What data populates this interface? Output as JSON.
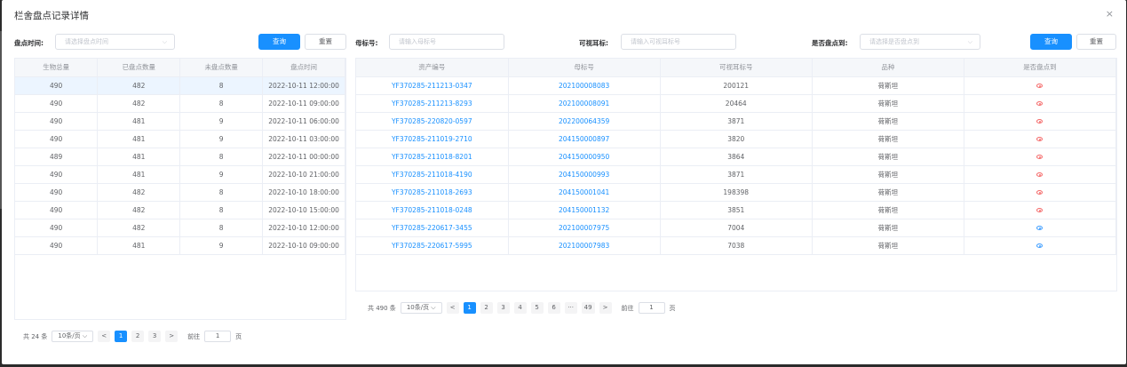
{
  "dialog": {
    "title": "栏舍盘点记录详情",
    "close": "×"
  },
  "left_filter": {
    "label": "盘点时间:",
    "placeholder": "请选择盘点时间",
    "query": "查询",
    "reset": "重置"
  },
  "right_filter": {
    "ear_label": "母标号:",
    "ear_placeholder": "请输入母标号",
    "visible_label": "可视耳标:",
    "visible_placeholder": "请输入可视耳标号",
    "counted_label": "是否盘点到:",
    "counted_placeholder": "请选择是否盘点到",
    "query": "查询",
    "reset": "重置"
  },
  "left_table": {
    "headers": [
      "生物总量",
      "已盘点数量",
      "未盘点数量",
      "盘点时间"
    ],
    "rows": [
      [
        "490",
        "482",
        "8",
        "2022-10-11 12:00:00"
      ],
      [
        "490",
        "482",
        "8",
        "2022-10-11 09:00:00"
      ],
      [
        "490",
        "481",
        "9",
        "2022-10-11 06:00:00"
      ],
      [
        "490",
        "481",
        "9",
        "2022-10-11 03:00:00"
      ],
      [
        "489",
        "481",
        "8",
        "2022-10-11 00:00:00"
      ],
      [
        "490",
        "481",
        "9",
        "2022-10-10 21:00:00"
      ],
      [
        "490",
        "482",
        "8",
        "2022-10-10 18:00:00"
      ],
      [
        "490",
        "482",
        "8",
        "2022-10-10 15:00:00"
      ],
      [
        "490",
        "482",
        "8",
        "2022-10-10 12:00:00"
      ],
      [
        "490",
        "481",
        "9",
        "2022-10-10 09:00:00"
      ]
    ]
  },
  "right_table": {
    "headers": [
      "资产编号",
      "母标号",
      "可视耳标号",
      "品种",
      "是否盘点到"
    ],
    "rows": [
      [
        "YF370285-211213-0347",
        "202100008083",
        "200121",
        "荷斯坦",
        "red"
      ],
      [
        "YF370285-211213-8293",
        "202100008091",
        "20464",
        "荷斯坦",
        "red"
      ],
      [
        "YF370285-220820-0597",
        "202200064359",
        "3871",
        "荷斯坦",
        "red"
      ],
      [
        "YF370285-211019-2710",
        "204150000897",
        "3820",
        "荷斯坦",
        "red"
      ],
      [
        "YF370285-211018-8201",
        "204150000950",
        "3864",
        "荷斯坦",
        "red"
      ],
      [
        "YF370285-211018-4190",
        "204150000993",
        "3871",
        "荷斯坦",
        "red"
      ],
      [
        "YF370285-211018-2693",
        "204150001041",
        "198398",
        "荷斯坦",
        "red"
      ],
      [
        "YF370285-211018-0248",
        "204150001132",
        "3851",
        "荷斯坦",
        "red"
      ],
      [
        "YF370285-220617-3455",
        "202100007975",
        "7004",
        "荷斯坦",
        "blue"
      ],
      [
        "YF370285-220617-5995",
        "202100007983",
        "7038",
        "荷斯坦",
        "blue"
      ]
    ]
  },
  "left_pager": {
    "total": "共 24 条",
    "size": "10条/页",
    "prev": "<",
    "pages": [
      "1",
      "2",
      "3"
    ],
    "next": ">",
    "goto_label": "前往",
    "goto_value": "1",
    "goto_unit": "页"
  },
  "right_pager": {
    "total": "共 490 条",
    "size": "10条/页",
    "prev": "<",
    "pages": [
      "1",
      "2",
      "3",
      "4",
      "5",
      "6",
      "···",
      "49"
    ],
    "next": ">",
    "goto_label": "前往",
    "goto_value": "1",
    "goto_unit": "页"
  },
  "colors": {
    "primary": "#1890ff",
    "red": "#f56c6c",
    "blue": "#409eff"
  }
}
